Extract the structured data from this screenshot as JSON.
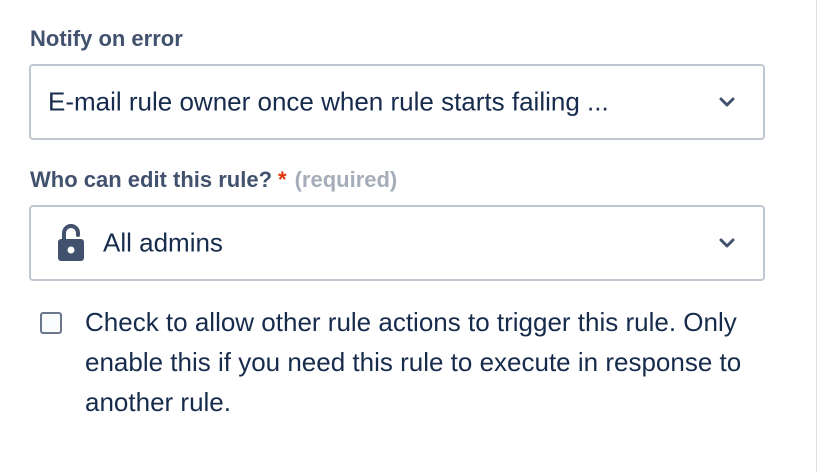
{
  "notify": {
    "label": "Notify on error",
    "selected": "E-mail rule owner once when rule starts failing ..."
  },
  "edit_permission": {
    "label": "Who can edit this rule?",
    "required_marker": "*",
    "required_text": "(required)",
    "selected": "All admins",
    "icon": "unlocked-padlock-icon"
  },
  "trigger_option": {
    "checked": false,
    "label": "Check to allow other rule actions to trigger this rule. Only enable this if you need this rule to execute in response to another rule."
  },
  "colors": {
    "label": "#42526e",
    "text": "#172b4d",
    "required_star": "#de350b",
    "required_text": "#a5adba",
    "border": "#c1c7d0"
  }
}
